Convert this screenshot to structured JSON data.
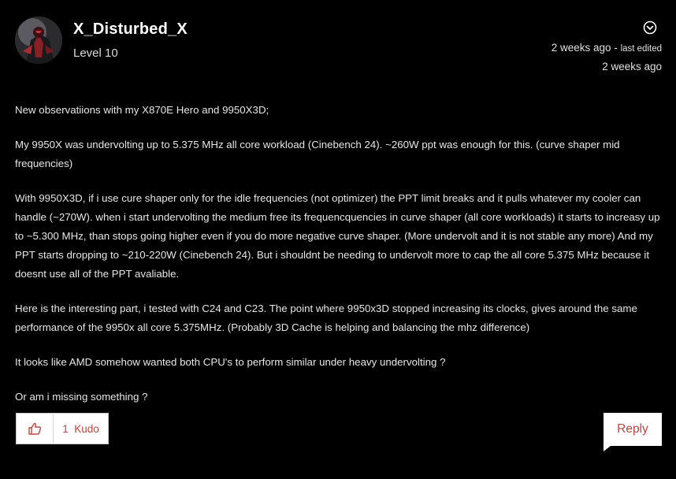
{
  "author": {
    "name": "X_Disturbed_X",
    "rank": "Level 10"
  },
  "meta": {
    "posted": "2 weeks ago",
    "edited_separator": " - ",
    "edited_label": "last edited",
    "edited_time": "2 weeks ago"
  },
  "post": {
    "paragraphs": [
      "New observatiions with my X870E Hero and 9950X3D;",
      "My 9950X was undervolting up to 5.375 MHz all core workload (Cinebench 24). ~260W ppt was enough for this. (curve shaper mid frequencies)",
      "With 9950X3D, if i use cure shaper only for the idle frequencies (not optimizer) the PPT limit breaks and it pulls whatever my cooler can handle (~270W). when i start undervolting the medium free its frequencquencies in curve shaper (all core workloads) it starts to increasy up to ~5.300 MHz, than stops going higher even if you do more negative curve shaper. (More undervolt and it is not stable any more) And my PPT starts dropping to ~210-220W (Cinebench 24). But i shouldnt be needing to undervolt more to cap the all core 5.375 MHz because it doesnt use all of the PPT avaliable.",
      "Here is the interesting part, i tested with C24 and C23. The point where 9950x3D stopped increasing its clocks, gives around the same performance of the 9950x all core 5.375MHz. (Probably 3D Cache is helping and balancing the mhz difference)",
      "It looks like AMD somehow wanted both CPU's to perform similar under heavy undervolting ?",
      "Or am i missing something ?"
    ]
  },
  "actions": {
    "kudo_label": "1  Kudo",
    "reply_label": "Reply"
  },
  "icons": {
    "options": "chevron-down-circle-icon",
    "kudo": "thumbs-up-icon"
  },
  "colors": {
    "background": "#000000",
    "accent": "#c0453b"
  }
}
